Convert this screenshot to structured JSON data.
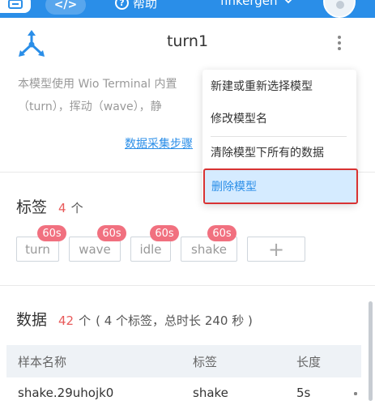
{
  "topbar": {
    "code_label": "</>",
    "help_label": "帮助",
    "help_icon": "?",
    "user_name": "finkergen"
  },
  "model": {
    "title": "turn1",
    "description_line1": "本模型使用 Wio Terminal 内置",
    "description_line2": "（turn），挥动（wave），静",
    "collect_link": "数据采集步骤"
  },
  "menu": {
    "items": [
      "新建或重新选择模型",
      "修改模型名",
      "清除模型下所有的数据",
      "删除模型"
    ]
  },
  "tags_section": {
    "title": "标签",
    "count": "4",
    "unit": "个",
    "tags": [
      {
        "name": "turn",
        "badge": "60s"
      },
      {
        "name": "wave",
        "badge": "60s"
      },
      {
        "name": "idle",
        "badge": "60s"
      },
      {
        "name": "shake",
        "badge": "60s"
      }
    ],
    "add_label": "+"
  },
  "data_section": {
    "title": "数据",
    "count": "42",
    "unit": "个",
    "meta": "( 4 个标签，总时长 240 秒 )"
  },
  "table": {
    "headers": [
      "样本名称",
      "标签",
      "长度"
    ],
    "rows": [
      {
        "name": "shake.29uhojk0",
        "label": "shake",
        "length": "5s"
      }
    ]
  },
  "colors": {
    "brand": "#2a8ee8",
    "count_red": "#e85a5a",
    "badge_pink": "#f1707f",
    "highlight": "#d5ebff",
    "outline_red": "#d83232"
  }
}
